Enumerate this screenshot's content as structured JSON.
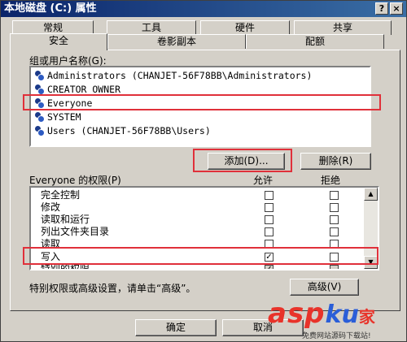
{
  "window": {
    "title": "本地磁盘 (C:) 属性",
    "help_glyph": "?",
    "close_glyph": "×"
  },
  "tabs_back": [
    "常规",
    "工具",
    "硬件",
    "共享"
  ],
  "tabs_front": [
    "安全",
    "卷影副本",
    "配额"
  ],
  "groups": {
    "label": "组或用户名称(G):",
    "users": [
      "Administrators (CHANJET-56F78BB\\Administrators)",
      "CREATOR OWNER",
      "Everyone",
      "SYSTEM",
      "Users (CHANJET-56F78BB\\Users)"
    ]
  },
  "buttons": {
    "add": "添加(D)...",
    "remove": "删除(R)",
    "advanced": "高级(V)",
    "ok": "确定",
    "cancel": "取消"
  },
  "permissions": {
    "label": "Everyone 的权限(P)",
    "allow_header": "允许",
    "deny_header": "拒绝",
    "rows": [
      {
        "name": "完全控制",
        "allow_mark": "",
        "deny_mark": ""
      },
      {
        "name": "修改",
        "allow_mark": "",
        "deny_mark": ""
      },
      {
        "name": "读取和运行",
        "allow_mark": "",
        "deny_mark": ""
      },
      {
        "name": "列出文件夹目录",
        "allow_mark": "",
        "deny_mark": ""
      },
      {
        "name": "读取",
        "allow_mark": "",
        "deny_mark": ""
      },
      {
        "name": "写入",
        "allow_mark": "✓",
        "deny_mark": ""
      },
      {
        "name": "特别的权限",
        "allow_mark": "✓",
        "deny_mark": ""
      }
    ]
  },
  "advanced_note": "特别权限或高级设置，请单击“高级”。",
  "watermark": {
    "brand_a": "asp",
    "brand_b": "ku",
    "brand_c": "家",
    "tagline": "免费网站源码下载站!"
  },
  "colors": {
    "highlight": "#e0303a",
    "title_bar": "#0a246a",
    "face": "#d4d0c8"
  }
}
